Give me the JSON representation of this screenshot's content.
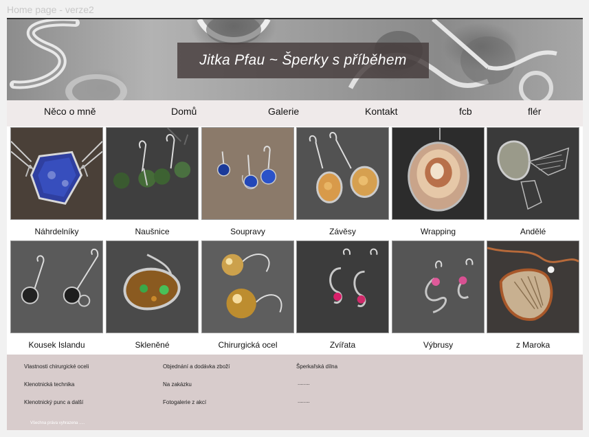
{
  "frame_label": "Home page - verze2",
  "hero": {
    "title": "Jitka Pfau ~ Šperky s příběhem"
  },
  "nav": [
    "Něco o mně",
    "Domů",
    "Galerie",
    "Kontakt",
    "fcb",
    "flér"
  ],
  "gallery": [
    {
      "label": "Náhrdelníky",
      "icon": "necklace-icon"
    },
    {
      "label": "Naušnice",
      "icon": "earrings-icon"
    },
    {
      "label": "Soupravy",
      "icon": "jewelry-set-icon"
    },
    {
      "label": "Závěsy",
      "icon": "pendant-earrings-icon"
    },
    {
      "label": "Wrapping",
      "icon": "wrapped-stone-icon"
    },
    {
      "label": "Andělé",
      "icon": "angel-brooch-icon"
    },
    {
      "label": "Kousek Islandu",
      "icon": "lava-stone-earrings-icon"
    },
    {
      "label": "Skleněné",
      "icon": "glass-brooch-icon"
    },
    {
      "label": "Chirurgická ocel",
      "icon": "amber-earrings-icon"
    },
    {
      "label": "Zvířata",
      "icon": "seahorse-earrings-icon"
    },
    {
      "label": "Výbrusy",
      "icon": "cut-stone-earrings-icon"
    },
    {
      "label": "z Maroka",
      "icon": "fossil-pendant-icon"
    }
  ],
  "footer": {
    "col1": [
      "Vlastnosti chirurgické oceli",
      "Klenotnická technika",
      "Klenotnický punc a další"
    ],
    "col2": [
      "Objednání a dodávka zboží",
      "Na zakázku",
      "Fotogalerie z akcí"
    ],
    "col3": [
      "Šperkařská dílna",
      "........",
      "........"
    ],
    "copyright": "Všechna práva vyhrazena ....."
  },
  "colors": {
    "nav_bg": "#efeaea",
    "footer_bg": "#d8cccc",
    "title_box": "#463c3c"
  }
}
